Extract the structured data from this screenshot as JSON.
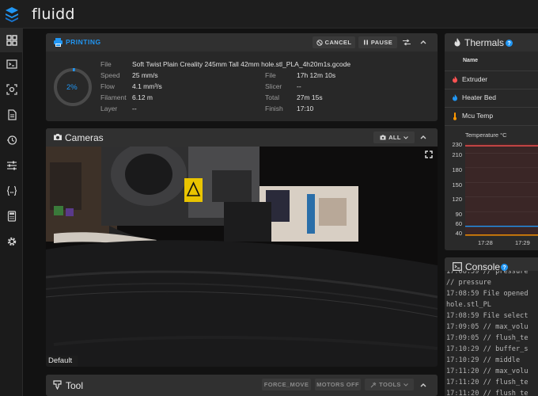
{
  "app": {
    "title": "fluidd"
  },
  "sidebar": {
    "items": [
      {
        "name": "dashboard-icon"
      },
      {
        "name": "console-icon"
      },
      {
        "name": "camera-focus-icon"
      },
      {
        "name": "file-icon"
      },
      {
        "name": "history-icon"
      },
      {
        "name": "tune-icon"
      },
      {
        "name": "code-braces-icon"
      },
      {
        "name": "calculator-icon"
      },
      {
        "name": "gear-icon"
      }
    ]
  },
  "printing": {
    "title": "PRINTING",
    "cancel_label": "CANCEL",
    "pause_label": "PAUSE",
    "progress_label": "2%",
    "progress_fraction": 0.02,
    "left": [
      {
        "label": "File",
        "value": "Soft Twist Plain Creality 245mm Tall 42mm hole.stl_PLA_4h20m1s.gcode"
      },
      {
        "label": "Speed",
        "value": "25 mm/s"
      },
      {
        "label": "Flow",
        "value": "4.1 mm³/s"
      },
      {
        "label": "Filament",
        "value": "6.12 m"
      },
      {
        "label": "Layer",
        "value": "--"
      }
    ],
    "right": [
      {
        "label": "File",
        "value": "17h 12m 10s"
      },
      {
        "label": "Slicer",
        "value": "--"
      },
      {
        "label": "Total",
        "value": "27m 15s"
      },
      {
        "label": "Finish",
        "value": "17:10"
      }
    ]
  },
  "cameras": {
    "title": "Cameras",
    "all_label": "ALL",
    "caption": "Default"
  },
  "tool": {
    "title": "Tool",
    "force_move_label": "FORCE_MOVE",
    "motors_off_label": "MOTORS OFF",
    "tools_label": "TOOLS"
  },
  "thermals": {
    "title": "Thermals",
    "name_header": "Name",
    "rows": [
      {
        "label": "Extruder",
        "color": "#ff5252"
      },
      {
        "label": "Heater Bed",
        "color": "#2196f3"
      },
      {
        "label": "Mcu Temp",
        "color": "#ff9800"
      }
    ],
    "chart_title": "Temperature °C",
    "y_ticks": [
      "230",
      "210",
      "180",
      "150",
      "120",
      "90",
      "60",
      "40"
    ],
    "x_ticks": [
      "17:28",
      "17:29"
    ]
  },
  "chart_data": {
    "type": "line",
    "title": "Temperature °C",
    "ylim": [
      40,
      230
    ],
    "x": [
      "17:28",
      "17:29"
    ],
    "series": [
      {
        "name": "Extruder",
        "color": "#ff5252",
        "values": [
          225,
          225
        ]
      },
      {
        "name": "Heater Bed",
        "color": "#2196f3",
        "values": [
          60,
          60
        ]
      },
      {
        "name": "Mcu Temp",
        "color": "#ff9800",
        "values": [
          42,
          42
        ]
      }
    ]
  },
  "console": {
    "title": "Console",
    "lines": [
      {
        "time": "17:08:59",
        "text": "// pressure"
      },
      {
        "time": "",
        "text": "  // pressure"
      },
      {
        "time": "17:08:59",
        "text": "File opened"
      },
      {
        "time": "",
        "text": "  hole.stl_PL"
      },
      {
        "time": "17:08:59",
        "text": "File select"
      },
      {
        "time": "17:09:05",
        "text": "// max_volu"
      },
      {
        "time": "17:09:05",
        "text": "// flush_te"
      },
      {
        "time": "17:10:29",
        "text": "// buffer_s"
      },
      {
        "time": "17:10:29",
        "text": "// middle"
      },
      {
        "time": "17:11:20",
        "text": "// max_volu"
      },
      {
        "time": "17:11:20",
        "text": "// flush_te"
      },
      {
        "time": "17:11:20",
        "text": "// flush_te"
      }
    ]
  }
}
